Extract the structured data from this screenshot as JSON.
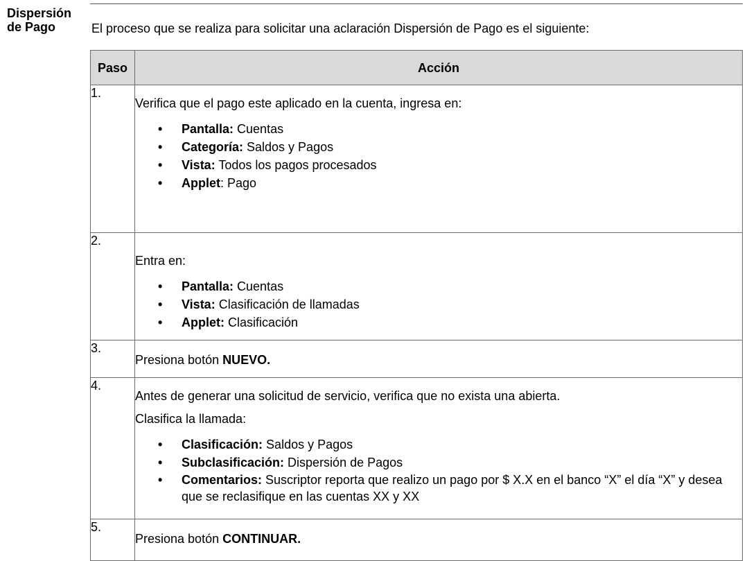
{
  "section_title": "Dispersión de Pago",
  "intro": "El proceso que se realiza para solicitar una aclaración Dispersión de Pago es el siguiente:",
  "table": {
    "headers": {
      "step": "Paso",
      "action": "Acción"
    },
    "rows": [
      {
        "num": "1.",
        "lines": [
          "Verifica que el pago este aplicado en la cuenta, ingresa en:"
        ],
        "bullets": [
          {
            "label": "Pantalla:",
            "text": " Cuentas"
          },
          {
            "label": "Categoría:",
            "text": " Saldos y Pagos"
          },
          {
            "label": "Vista:",
            "text": " Todos los pagos procesados"
          },
          {
            "label": "Applet",
            "text": ": Pago"
          }
        ]
      },
      {
        "num": "2.",
        "lines": [
          "Entra en:"
        ],
        "bullets": [
          {
            "label": "Pantalla:",
            "text": " Cuentas"
          },
          {
            "label": "Vista:",
            "text": " Clasificación de llamadas"
          },
          {
            "label": "Applet:",
            "text": " Clasificación"
          }
        ]
      },
      {
        "num": "3.",
        "text": "Presiona botón ",
        "bold": "NUEVO."
      },
      {
        "num": "4.",
        "lines": [
          "Antes de generar una solicitud de servicio, verifica que no exista una abierta.",
          "Clasifica la llamada:"
        ],
        "bullets": [
          {
            "label": "Clasificación:",
            "text": " Saldos y Pagos"
          },
          {
            "label": "Subclasificación:",
            "text": " Dispersión de Pagos"
          },
          {
            "label": "Comentarios:",
            "text": " Suscriptor reporta que realizo un pago por $ X.X en el banco “X” el día “X” y desea que se reclasifique en las cuentas XX y XX"
          }
        ]
      },
      {
        "num": "5.",
        "text": "Presiona botón ",
        "bold": "CONTINUAR."
      }
    ]
  }
}
